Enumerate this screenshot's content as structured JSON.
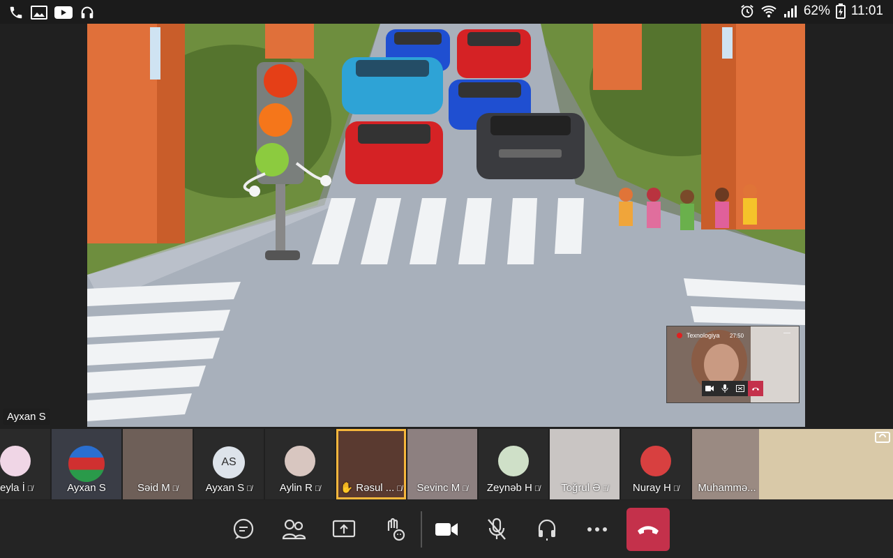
{
  "status_bar": {
    "battery": "62%",
    "time": "11:01"
  },
  "stage": {
    "speaker_label": "Ayxan S"
  },
  "pip": {
    "title": "Texnologiya",
    "timer": "27:50",
    "minimize": "—"
  },
  "participants": [
    {
      "label": "eyla İ",
      "kind": "avatar",
      "muted": true
    },
    {
      "label": "Ayxan S",
      "kind": "avatar-flag",
      "muted": false
    },
    {
      "label": "Səid M",
      "kind": "video",
      "muted": true
    },
    {
      "label": "Ayxan S",
      "kind": "initials",
      "initials": "AS",
      "muted": true
    },
    {
      "label": "Aylin R",
      "kind": "avatar",
      "muted": true
    },
    {
      "label": "✋ Rəsul ...",
      "kind": "video",
      "muted": true,
      "active": true
    },
    {
      "label": "Sevinc M",
      "kind": "video",
      "muted": true
    },
    {
      "label": "Zeynəb H",
      "kind": "avatar",
      "muted": true
    },
    {
      "label": "Toğrul Ə",
      "kind": "video",
      "muted": true
    },
    {
      "label": "Nuray H",
      "kind": "avatar",
      "muted": true
    },
    {
      "label": "Muhammə...",
      "kind": "video",
      "muted": false
    },
    {
      "label": "",
      "kind": "video",
      "muted": false
    }
  ],
  "colors": {
    "hangup": "#c4314b",
    "active_border": "#f6b73c",
    "background": "#202020"
  },
  "icons": [
    "chat-icon",
    "participants-icon",
    "share-icon",
    "react-icon",
    "camera-icon",
    "mic-off-icon",
    "audio-icon",
    "more-icon",
    "hangup-icon"
  ]
}
